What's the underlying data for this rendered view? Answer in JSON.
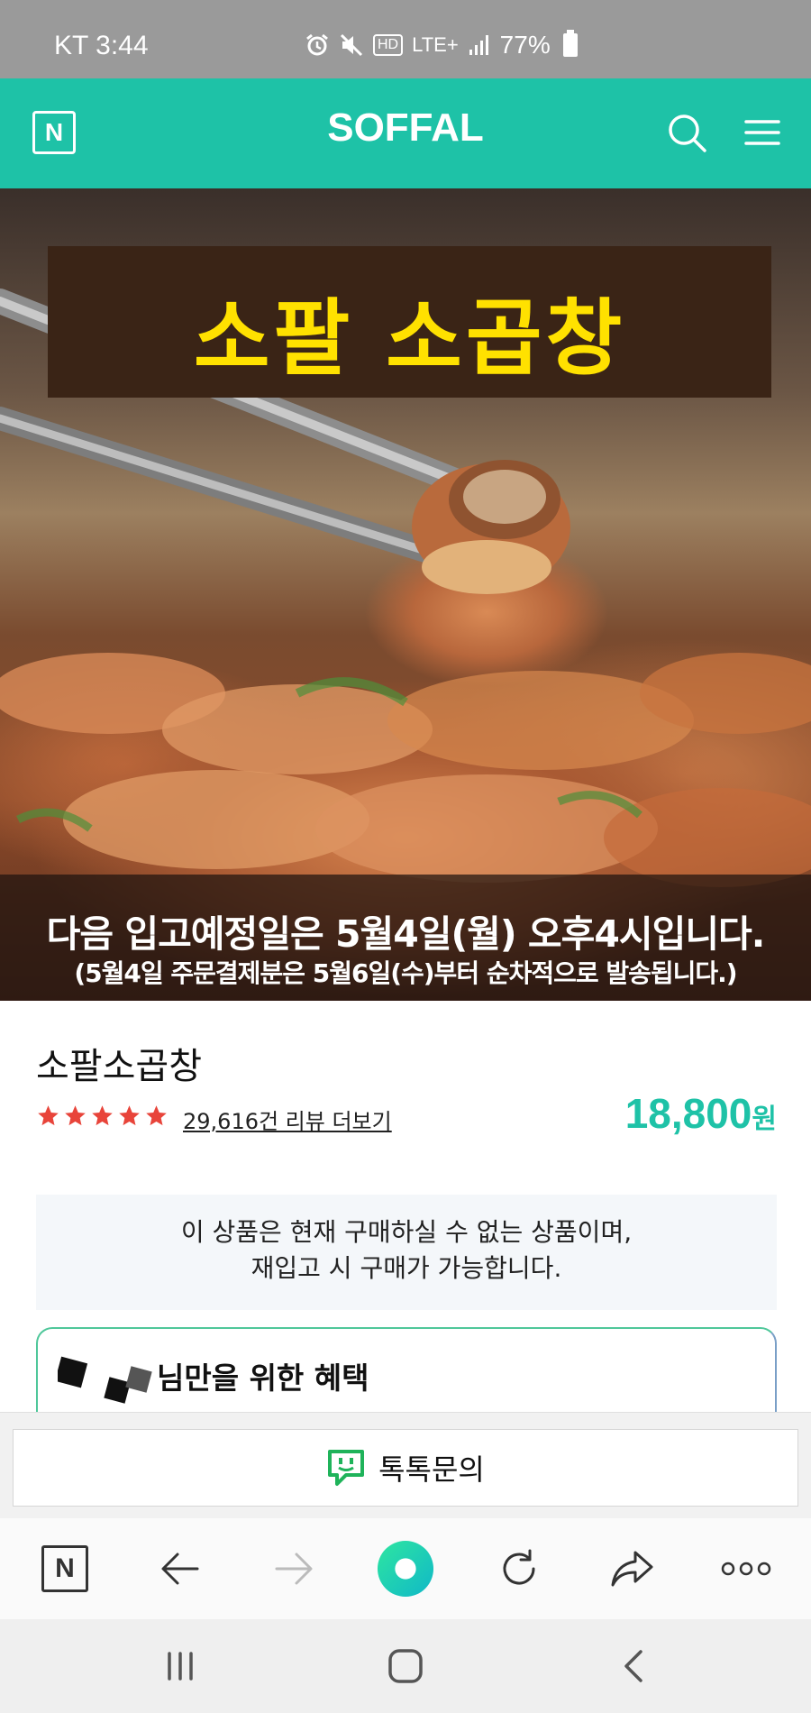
{
  "status_bar": {
    "carrier_time": "KT 3:44",
    "network": "LTE+",
    "hd": "HD",
    "battery": "77%"
  },
  "header": {
    "logo": "N",
    "title": "SOFFAL",
    "accent_color": "#1ec2a7"
  },
  "hero": {
    "title": "소팔 소곱창",
    "notice_line1": "다음 입고예정일은 5월4일(월) 오후4시입니다.",
    "notice_line2": "(5월4일 주문결제분은 5월6일(수)부터 순차적으로 발송됩니다.)"
  },
  "product": {
    "name": "소팔소곱창",
    "rating_stars": 5,
    "review_link": "29,616건 리뷰 더보기",
    "price": "18,800",
    "price_unit": "원"
  },
  "soldout": {
    "line1": "이 상품은 현재 구매하실 수 없는 상품이며,",
    "line2": "재입고 시 구매가 가능합니다."
  },
  "benefit": {
    "text": "님만을 위한 혜택"
  },
  "talk": {
    "label": "톡톡문의"
  },
  "browser_toolbar": {
    "home": "N"
  }
}
